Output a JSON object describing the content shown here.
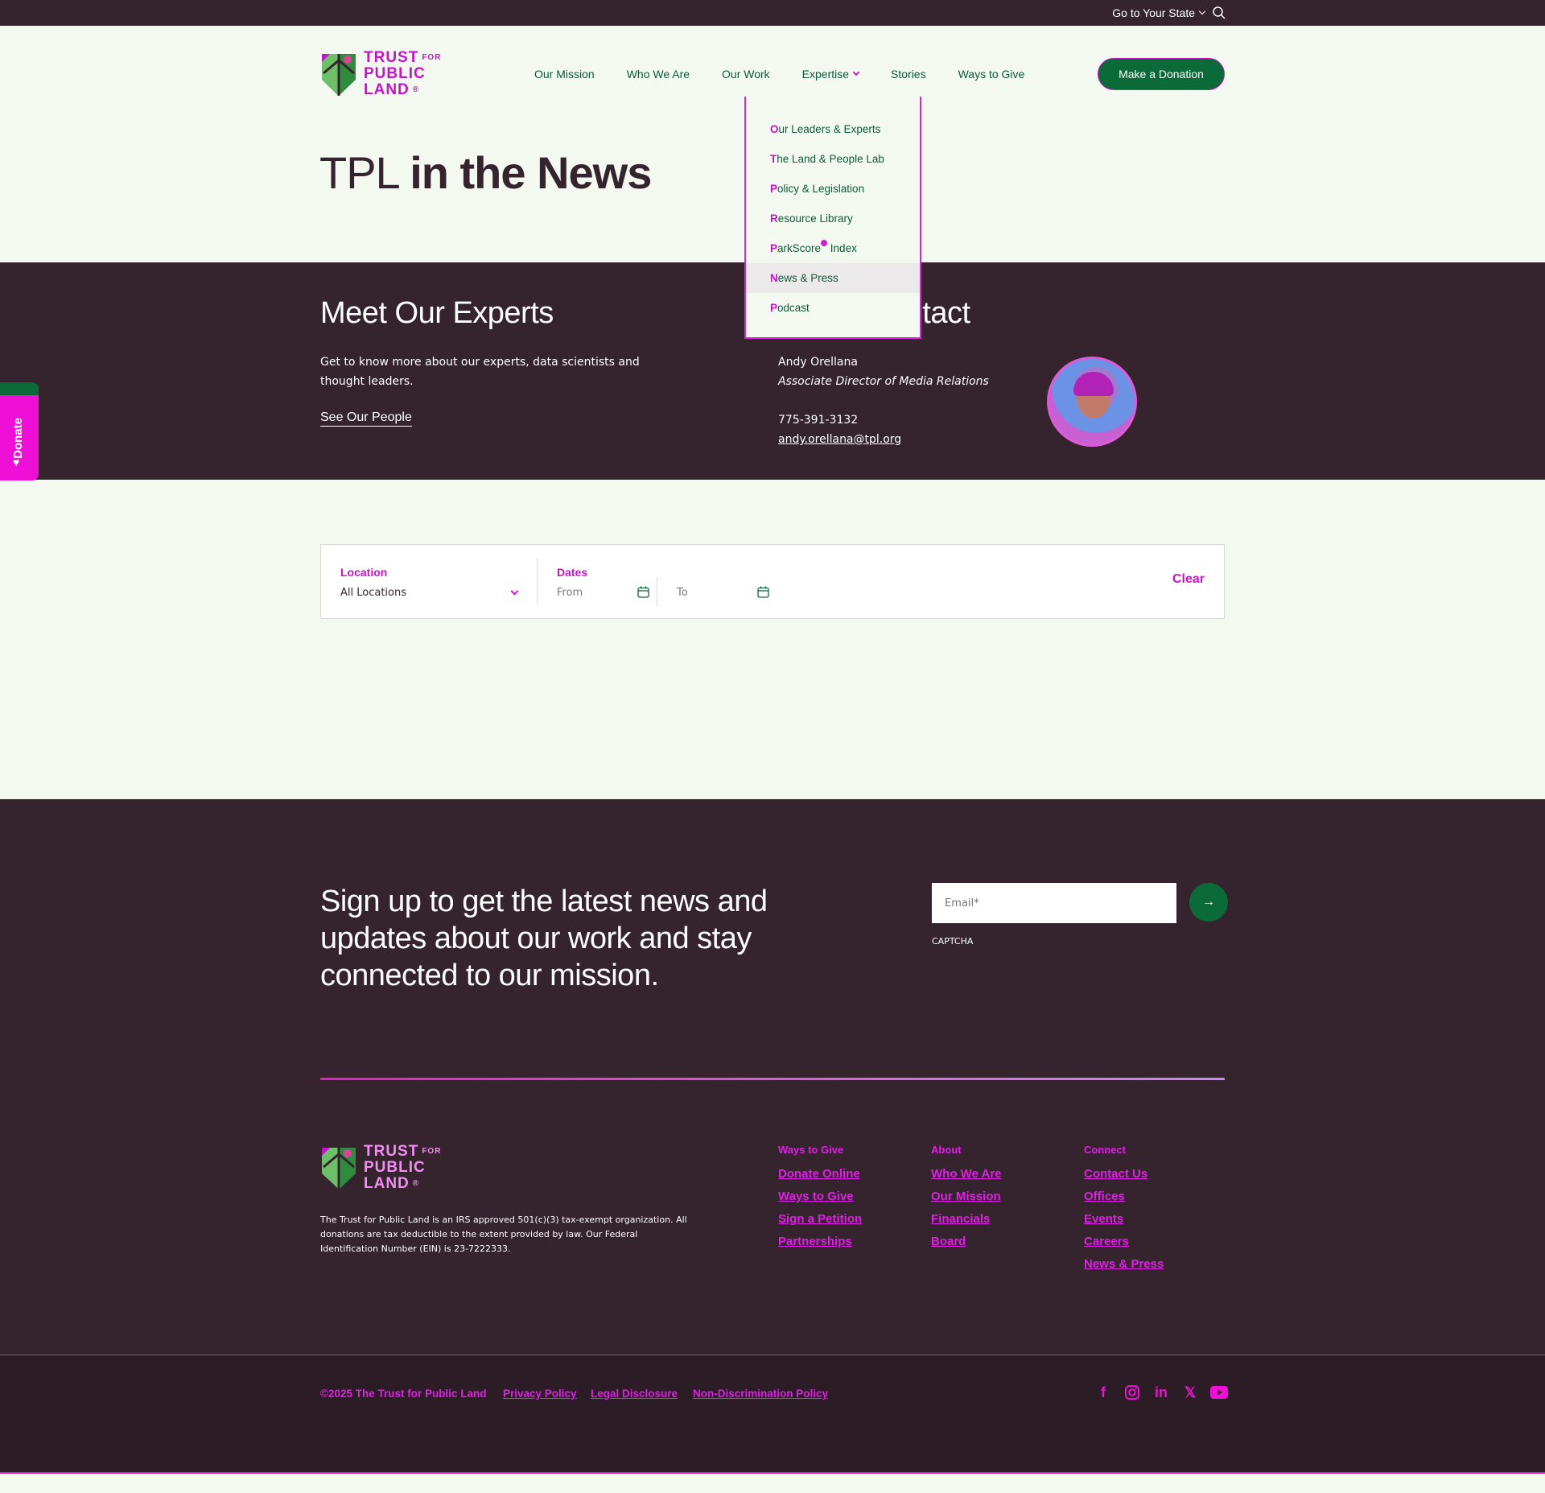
{
  "utility": {
    "state_label": "Go to Your State"
  },
  "brand": {
    "line1": "TRUST",
    "for": "FOR",
    "line2": "PUBLIC",
    "line3": "LAND",
    "reg": "®"
  },
  "nav": {
    "items": [
      "Our Mission",
      "Who We Are",
      "Our Work",
      "Expertise",
      "Stories",
      "Ways to Give"
    ],
    "cta": "Make a Donation"
  },
  "page": {
    "title_light": "TPL ",
    "title_bold": "in the News"
  },
  "dropdown": {
    "items": [
      {
        "first": "O",
        "rest": "ur Leaders & Experts"
      },
      {
        "first": "T",
        "rest": "he Land & People Lab"
      },
      {
        "first": "P",
        "rest": "olicy & Legislation"
      },
      {
        "first": "R",
        "rest": "esource Library"
      },
      {
        "first": "P",
        "rest": "arkScore",
        "tail": " Index"
      },
      {
        "first": "N",
        "rest": "ews & Press"
      },
      {
        "first": "P",
        "rest": "odcast"
      }
    ]
  },
  "experts": {
    "heading": "Meet Our Experts",
    "description": "Get to know more about our experts, data scientists and thought leaders.",
    "link": "See Our People"
  },
  "media": {
    "heading": "Media Contact",
    "name": "Andy Orellana",
    "role": "Associate Director of Media Relations",
    "phone": "775-391-3132",
    "email": "andy.orellana@tpl.org"
  },
  "side_tab": {
    "label": "Donate"
  },
  "filters": {
    "location_label": "Location",
    "location_value": "All Locations",
    "dates_label": "Dates",
    "from_placeholder": "From",
    "to_placeholder": "To",
    "clear": "Clear"
  },
  "newsletter": {
    "text": "Sign up to get the latest news and updates about our work and stay connected to our mission.",
    "email_placeholder": "Email*",
    "captcha": "CAPTCHA"
  },
  "footer": {
    "note": "The Trust for Public Land is an IRS approved 501(c)(3) tax-exempt organization. All donations are tax deductible to the extent provided by law. Our Federal Identification Number (EIN) is 23-7222333.",
    "columns": [
      {
        "head": "Ways to Give",
        "links": [
          "Donate Online",
          "Ways to Give",
          "Sign a Petition",
          "Partnerships"
        ]
      },
      {
        "head": "About",
        "links": [
          "Who We Are",
          "Our Mission",
          "Financials",
          "Board"
        ]
      },
      {
        "head": "Connect",
        "links": [
          "Contact Us",
          "Offices",
          "Events",
          "Careers",
          "News & Press"
        ]
      }
    ],
    "copyright": "©2025 The Trust for Public Land",
    "legal": [
      "Privacy Policy",
      "Legal Disclosure",
      "Non-Discrimination Policy"
    ],
    "social_icons": [
      "facebook-icon",
      "instagram-icon",
      "linkedin-icon",
      "x-icon",
      "youtube-icon"
    ]
  },
  "colors": {
    "dark": "#35242d",
    "green": "#0a6a38",
    "magenta": "#c414c8",
    "bg": "#f3f8f0"
  }
}
